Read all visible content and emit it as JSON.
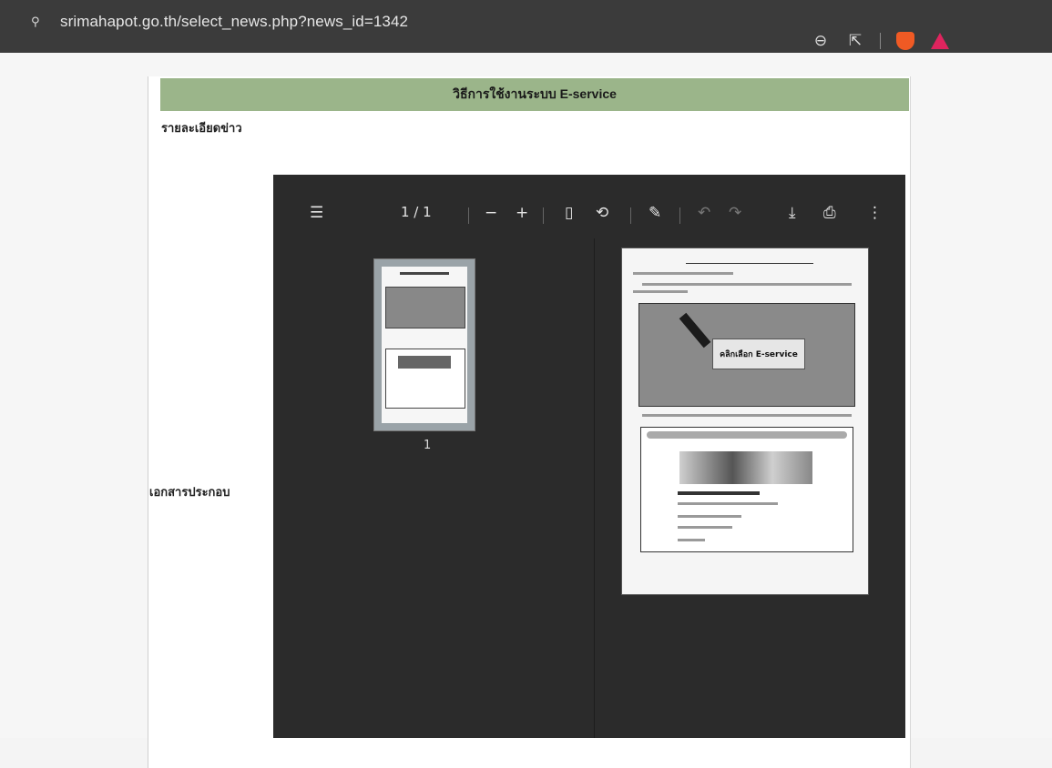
{
  "browser": {
    "url": "srimahapot.go.th/select_news.php?news_id=1342"
  },
  "page": {
    "title": "วิธีการใช้งานระบบ E-service",
    "detail_label": "รายละเอียดข่าว",
    "attachment_label": "เอกสารประกอบ"
  },
  "pdf_viewer": {
    "page_indicator": "1 / 1",
    "zoom_out": "−",
    "zoom_in": "+",
    "thumbnail_page_number": "1",
    "preview_banner": "คลิกเลือก E-service"
  }
}
